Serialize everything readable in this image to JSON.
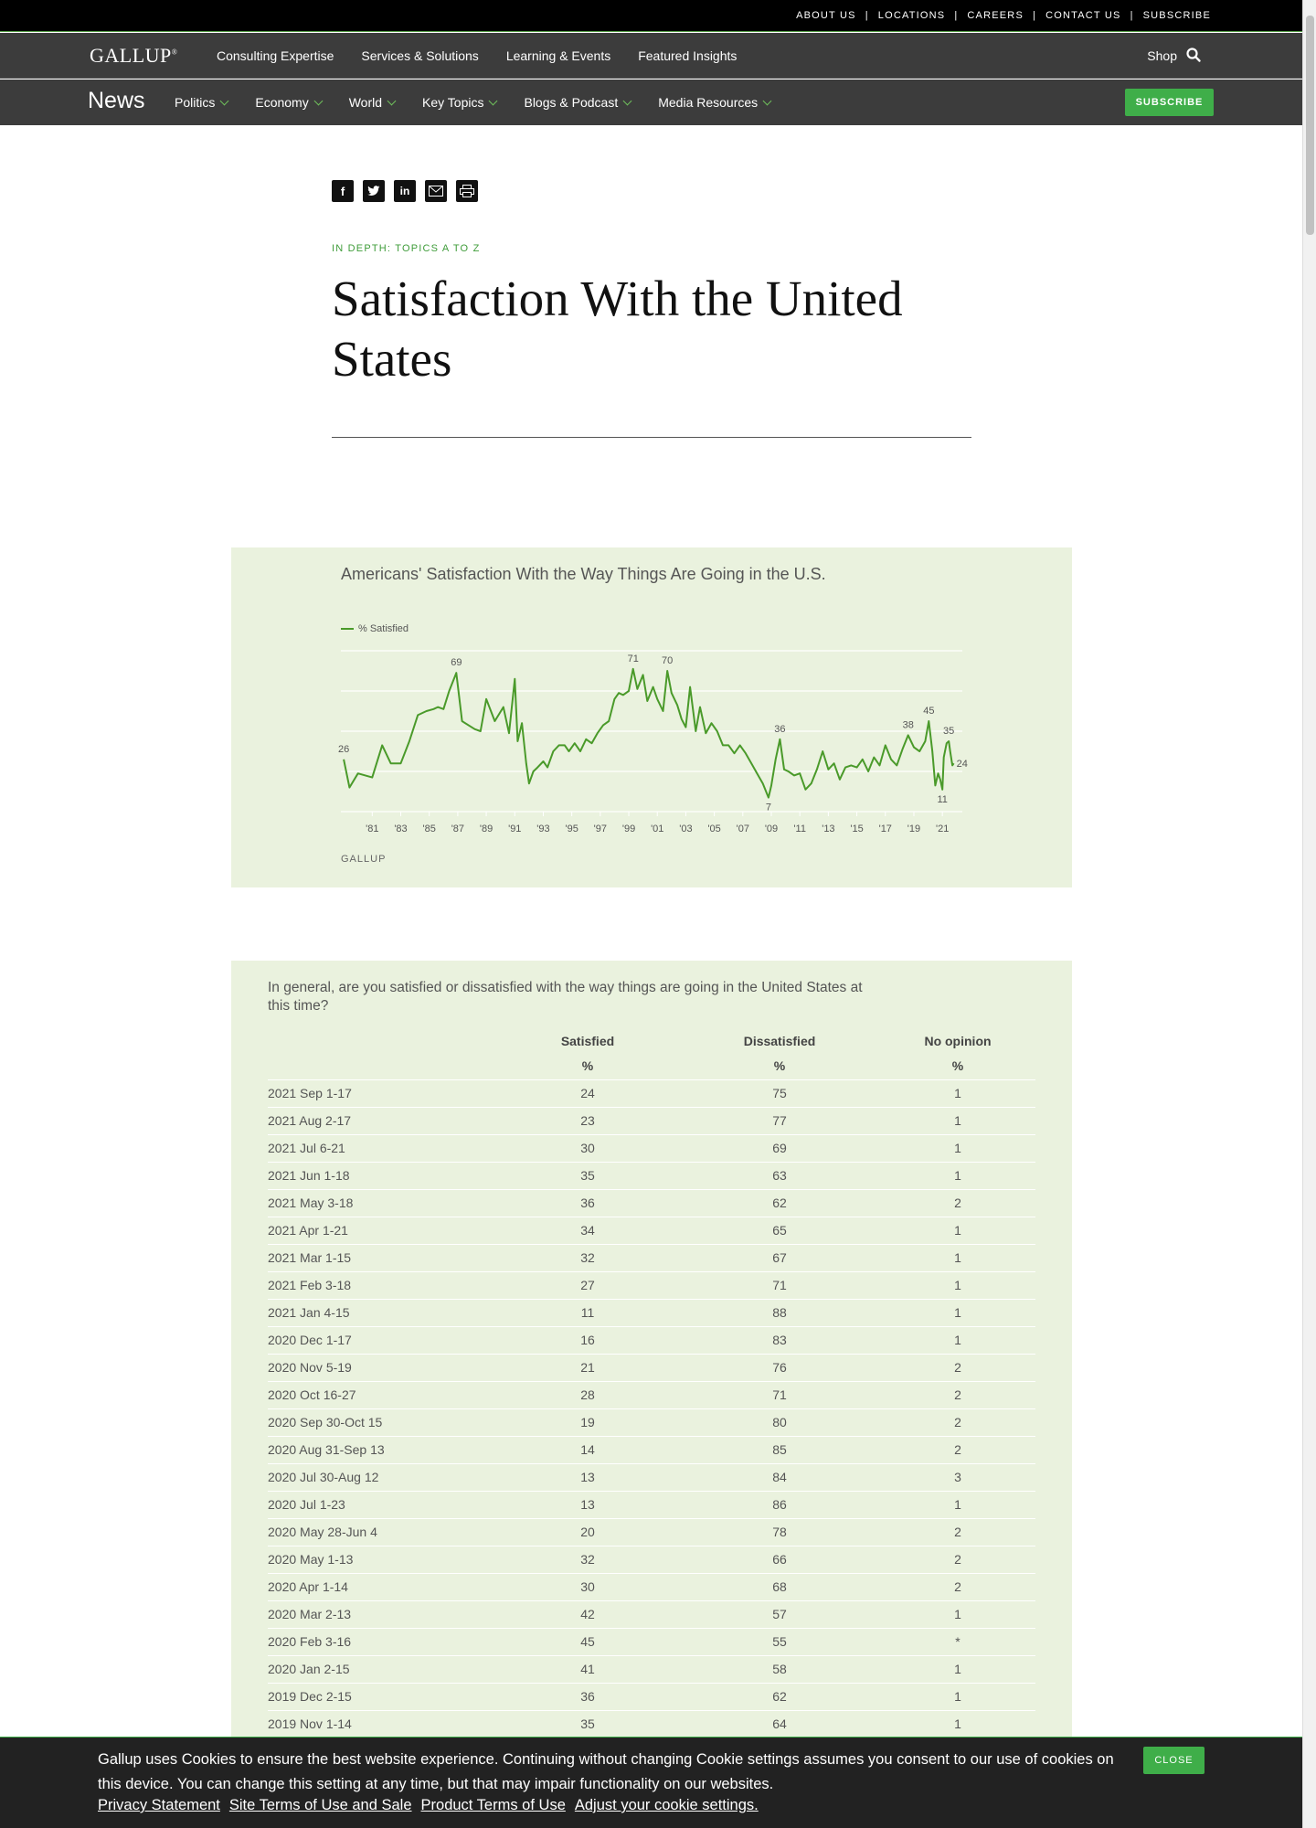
{
  "util_nav": [
    "ABOUT US",
    "LOCATIONS",
    "CAREERS",
    "CONTACT US",
    "SUBSCRIBE"
  ],
  "main_nav": {
    "logo": "GALLUP",
    "links": [
      "Consulting Expertise",
      "Services & Solutions",
      "Learning & Events",
      "Featured Insights"
    ],
    "shop": "Shop",
    "search_icon": "search-icon"
  },
  "news_nav": {
    "title": "News",
    "categories": [
      "Politics",
      "Economy",
      "World",
      "Key Topics",
      "Blogs & Podcast",
      "Media Resources"
    ],
    "subscribe": "SUBSCRIBE"
  },
  "share_icons": [
    "facebook-icon",
    "twitter-icon",
    "linkedin-icon",
    "email-icon",
    "print-icon"
  ],
  "article": {
    "kicker": "IN DEPTH: TOPICS A TO Z",
    "title": "Satisfaction With the United States"
  },
  "chart_data": {
    "type": "line",
    "title": "Americans' Satisfaction With the Way Things Are Going in the U.S.",
    "legend": [
      "% Satisfied"
    ],
    "series": [
      {
        "name": "% Satisfied",
        "color": "#4a9a2a",
        "points": [
          [
            1979.0,
            26
          ],
          [
            1979.4,
            12
          ],
          [
            1980.0,
            19
          ],
          [
            1981.0,
            17
          ],
          [
            1981.7,
            33
          ],
          [
            1982.3,
            24
          ],
          [
            1983.0,
            24
          ],
          [
            1983.6,
            35
          ],
          [
            1984.2,
            48
          ],
          [
            1984.8,
            50
          ],
          [
            1985.3,
            51
          ],
          [
            1985.6,
            52
          ],
          [
            1986.0,
            51
          ],
          [
            1986.4,
            60
          ],
          [
            1986.9,
            69
          ],
          [
            1987.3,
            45
          ],
          [
            1988.2,
            41
          ],
          [
            1988.6,
            40
          ],
          [
            1989.0,
            56
          ],
          [
            1989.6,
            45
          ],
          [
            1990.2,
            52
          ],
          [
            1990.6,
            39
          ],
          [
            1991.0,
            66
          ],
          [
            1991.2,
            35
          ],
          [
            1991.5,
            44
          ],
          [
            1991.8,
            24
          ],
          [
            1992.0,
            14
          ],
          [
            1992.3,
            20
          ],
          [
            1992.6,
            22
          ],
          [
            1993.0,
            25
          ],
          [
            1993.3,
            22
          ],
          [
            1993.7,
            30
          ],
          [
            1994.1,
            33
          ],
          [
            1994.5,
            33
          ],
          [
            1994.8,
            30
          ],
          [
            1995.2,
            34
          ],
          [
            1995.6,
            30
          ],
          [
            1996.0,
            36
          ],
          [
            1996.4,
            34
          ],
          [
            1996.8,
            39
          ],
          [
            1997.2,
            43
          ],
          [
            1997.6,
            45
          ],
          [
            1998.0,
            56
          ],
          [
            1998.3,
            59
          ],
          [
            1998.6,
            58
          ],
          [
            1999.0,
            60
          ],
          [
            1999.3,
            71
          ],
          [
            1999.6,
            61
          ],
          [
            2000.0,
            68
          ],
          [
            2000.3,
            55
          ],
          [
            2000.7,
            62
          ],
          [
            2001.0,
            56
          ],
          [
            2001.4,
            50
          ],
          [
            2001.7,
            70
          ],
          [
            2002.0,
            59
          ],
          [
            2002.4,
            53
          ],
          [
            2002.7,
            46
          ],
          [
            2003.0,
            42
          ],
          [
            2003.3,
            62
          ],
          [
            2003.7,
            40
          ],
          [
            2004.0,
            52
          ],
          [
            2004.4,
            39
          ],
          [
            2004.8,
            44
          ],
          [
            2005.2,
            40
          ],
          [
            2005.6,
            33
          ],
          [
            2006.0,
            33
          ],
          [
            2006.4,
            29
          ],
          [
            2006.8,
            33
          ],
          [
            2007.2,
            29
          ],
          [
            2007.6,
            24
          ],
          [
            2008.0,
            19
          ],
          [
            2008.4,
            14
          ],
          [
            2008.8,
            7
          ],
          [
            2009.0,
            13
          ],
          [
            2009.3,
            26
          ],
          [
            2009.6,
            36
          ],
          [
            2009.9,
            21
          ],
          [
            2010.2,
            20
          ],
          [
            2010.6,
            18
          ],
          [
            2011.0,
            19
          ],
          [
            2011.4,
            11
          ],
          [
            2011.8,
            14
          ],
          [
            2012.2,
            21
          ],
          [
            2012.6,
            30
          ],
          [
            2013.0,
            21
          ],
          [
            2013.4,
            24
          ],
          [
            2013.8,
            16
          ],
          [
            2014.2,
            22
          ],
          [
            2014.6,
            23
          ],
          [
            2015.0,
            22
          ],
          [
            2015.4,
            26
          ],
          [
            2015.8,
            20
          ],
          [
            2016.2,
            27
          ],
          [
            2016.6,
            23
          ],
          [
            2017.0,
            33
          ],
          [
            2017.4,
            26
          ],
          [
            2017.8,
            23
          ],
          [
            2018.2,
            31
          ],
          [
            2018.6,
            38
          ],
          [
            2019.0,
            32
          ],
          [
            2019.4,
            30
          ],
          [
            2019.8,
            35
          ],
          [
            2020.05,
            45
          ],
          [
            2020.3,
            30
          ],
          [
            2020.5,
            13
          ],
          [
            2020.7,
            19
          ],
          [
            2020.85,
            16
          ],
          [
            2021.0,
            11
          ],
          [
            2021.1,
            27
          ],
          [
            2021.3,
            34
          ],
          [
            2021.45,
            35
          ],
          [
            2021.55,
            30
          ],
          [
            2021.7,
            23
          ],
          [
            2021.8,
            24
          ]
        ]
      }
    ],
    "annotations": [
      {
        "x": 1979.0,
        "y": 26,
        "label": "26"
      },
      {
        "x": 1986.9,
        "y": 69,
        "label": "69"
      },
      {
        "x": 1999.3,
        "y": 71,
        "label": "71"
      },
      {
        "x": 2001.7,
        "y": 70,
        "label": "70"
      },
      {
        "x": 2009.6,
        "y": 36,
        "label": "36"
      },
      {
        "x": 2008.8,
        "y": 7,
        "label": "7"
      },
      {
        "x": 2018.6,
        "y": 38,
        "label": "38"
      },
      {
        "x": 2020.05,
        "y": 45,
        "label": "45"
      },
      {
        "x": 2021.45,
        "y": 35,
        "label": "35"
      },
      {
        "x": 2021.8,
        "y": 24,
        "label": "24"
      },
      {
        "x": 2021.0,
        "y": 11,
        "label": "11"
      }
    ],
    "x_ticks": [
      "'81",
      "'83",
      "'85",
      "'87",
      "'89",
      "'91",
      "'93",
      "'95",
      "'97",
      "'99",
      "'01",
      "'03",
      "'05",
      "'07",
      "'09",
      "'11",
      "'13",
      "'15",
      "'17",
      "'19",
      "'21"
    ],
    "x_tick_years": [
      1981,
      1983,
      1985,
      1987,
      1989,
      1991,
      1993,
      1995,
      1997,
      1999,
      2001,
      2003,
      2005,
      2007,
      2009,
      2011,
      2013,
      2015,
      2017,
      2019,
      2021
    ],
    "xlim": [
      1978.8,
      2022.4
    ],
    "ylim": [
      0,
      80
    ],
    "grid": true,
    "source": "GALLUP"
  },
  "table": {
    "question": "In general, are you satisfied or dissatisfied with the way things are going in the United States at this time?",
    "columns": [
      "",
      "Satisfied",
      "Dissatisfied",
      "No opinion"
    ],
    "units": [
      "",
      "%",
      "%",
      "%"
    ],
    "rows": [
      [
        "2021 Sep 1-17",
        "24",
        "75",
        "1"
      ],
      [
        "2021 Aug 2-17",
        "23",
        "77",
        "1"
      ],
      [
        "2021 Jul 6-21",
        "30",
        "69",
        "1"
      ],
      [
        "2021 Jun 1-18",
        "35",
        "63",
        "1"
      ],
      [
        "2021 May 3-18",
        "36",
        "62",
        "2"
      ],
      [
        "2021 Apr 1-21",
        "34",
        "65",
        "1"
      ],
      [
        "2021 Mar 1-15",
        "32",
        "67",
        "1"
      ],
      [
        "2021 Feb 3-18",
        "27",
        "71",
        "1"
      ],
      [
        "2021 Jan 4-15",
        "11",
        "88",
        "1"
      ],
      [
        "2020 Dec 1-17",
        "16",
        "83",
        "1"
      ],
      [
        "2020 Nov 5-19",
        "21",
        "76",
        "2"
      ],
      [
        "2020 Oct 16-27",
        "28",
        "71",
        "2"
      ],
      [
        "2020 Sep 30-Oct 15",
        "19",
        "80",
        "2"
      ],
      [
        "2020 Aug 31-Sep 13",
        "14",
        "85",
        "2"
      ],
      [
        "2020 Jul 30-Aug 12",
        "13",
        "84",
        "3"
      ],
      [
        "2020 Jul 1-23",
        "13",
        "86",
        "1"
      ],
      [
        "2020 May 28-Jun 4",
        "20",
        "78",
        "2"
      ],
      [
        "2020 May 1-13",
        "32",
        "66",
        "2"
      ],
      [
        "2020 Apr 1-14",
        "30",
        "68",
        "2"
      ],
      [
        "2020 Mar 2-13",
        "42",
        "57",
        "1"
      ],
      [
        "2020 Feb 3-16",
        "45",
        "55",
        "*"
      ],
      [
        "2020 Jan 2-15",
        "41",
        "58",
        "1"
      ],
      [
        "2019 Dec 2-15",
        "36",
        "62",
        "1"
      ],
      [
        "2019 Nov 1-14",
        "35",
        "64",
        "1"
      ]
    ]
  },
  "cookie": {
    "text": "Gallup uses Cookies to ensure the best website experience. Continuing without changing Cookie settings assumes you consent to our use of cookies on this device. You can change this setting at any time, but that may impair functionality on our websites.",
    "links": [
      "Privacy Statement",
      "Site Terms of Use and Sale",
      "Product Terms of Use",
      "Adjust your cookie settings."
    ],
    "close": "CLOSE"
  }
}
